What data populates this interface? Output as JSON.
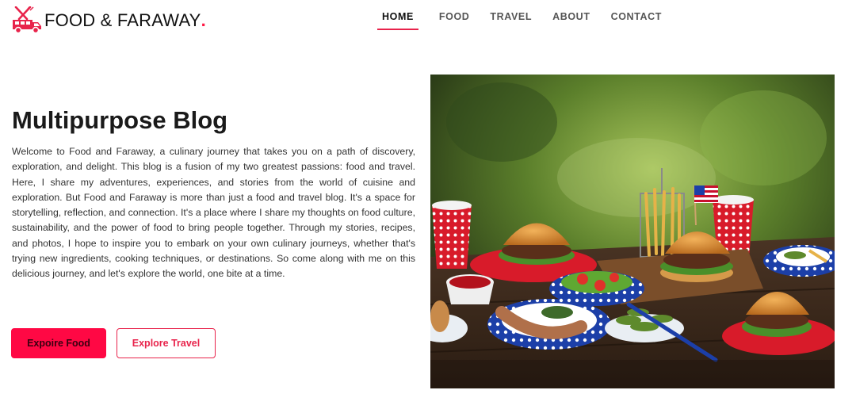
{
  "brand": {
    "name": "FOOD & FARAWAY",
    "dot": ".",
    "accent_color": "#e8234b",
    "icon": "food-truck-icon"
  },
  "nav": {
    "items": [
      {
        "label": "HOME",
        "active": true
      },
      {
        "label": "FOOD",
        "active": false
      },
      {
        "label": "TRAVEL",
        "active": false
      },
      {
        "label": "ABOUT",
        "active": false
      },
      {
        "label": "CONTACT",
        "active": false
      }
    ]
  },
  "hero": {
    "title": "Multipurpose Blog",
    "description": "Welcome to Food and Faraway, a culinary journey that takes you on a path of discovery, exploration, and delight. This blog is a fusion of my two greatest passions: food and travel. Here, I share my adventures, experiences, and stories from the world of cuisine and exploration. But Food and Faraway is more than just a food and travel blog. It's a space for storytelling, reflection, and connection. It's a place where I share my thoughts on food culture, sustainability, and the power of food to bring people together. Through my stories, recipes, and photos, I hope to inspire you to embark on your own culinary journeys, whether that's trying new ingredients, cooking techniques, or destinations. So come along with me on this delicious journey, and let's explore the world, one bite at a time.",
    "buttons": {
      "primary": "Expoire Food",
      "secondary": "Explore Travel"
    },
    "image": "picnic-food-photo"
  }
}
